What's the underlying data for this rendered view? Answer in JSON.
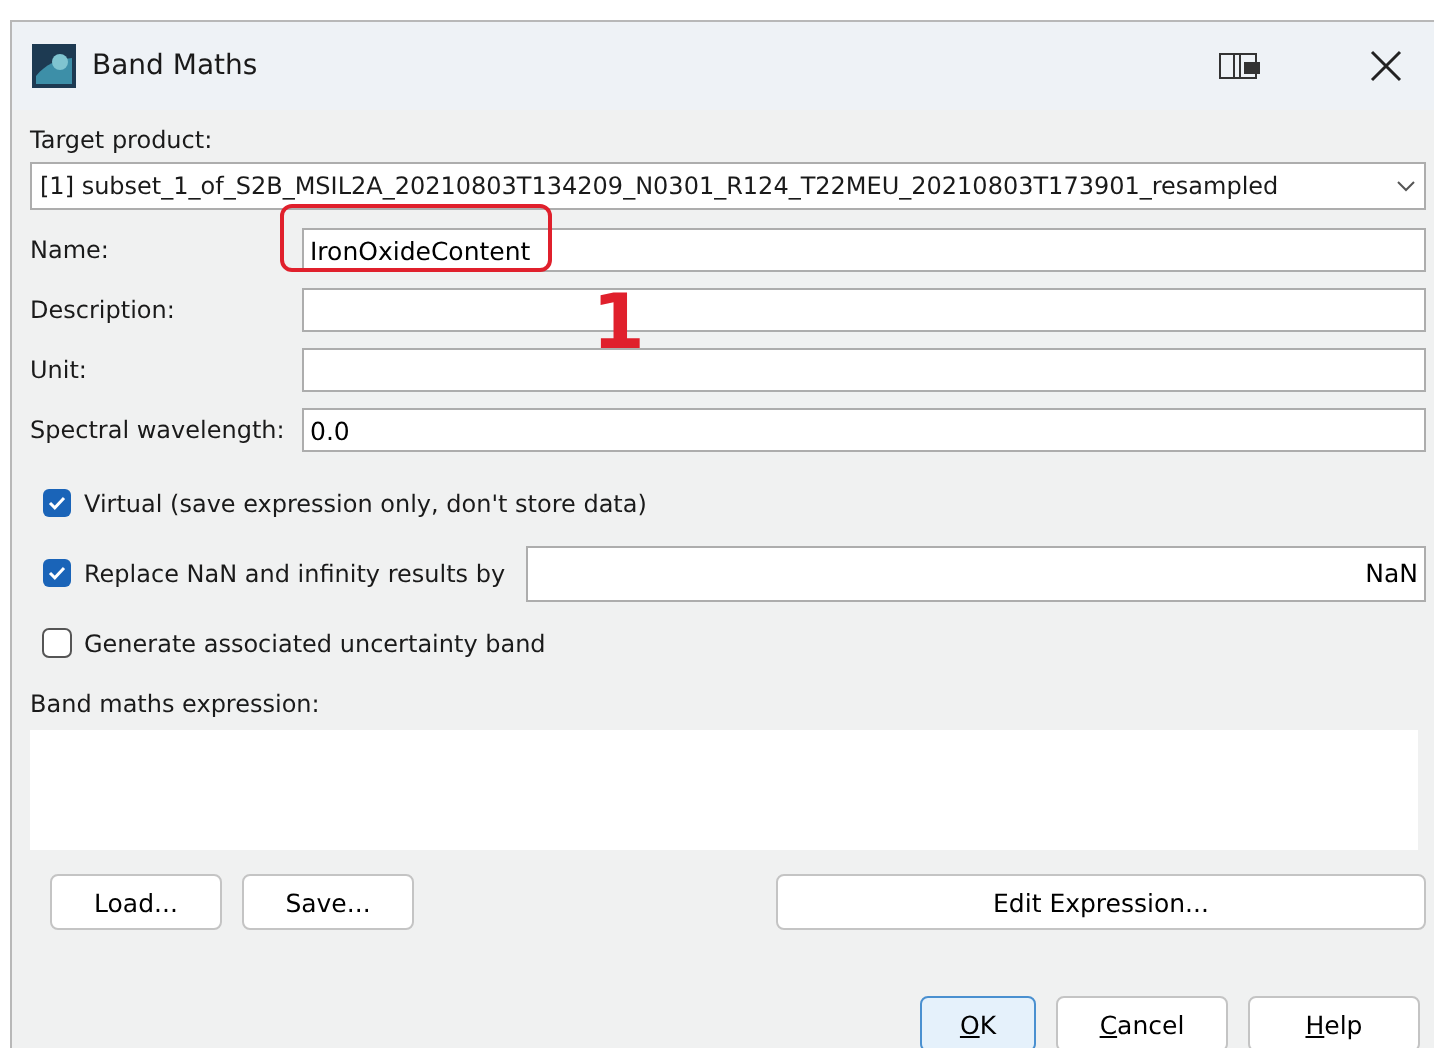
{
  "window": {
    "title": "Band Maths"
  },
  "target_product": {
    "label": "Target product:",
    "value": "[1] subset_1_of_S2B_MSIL2A_20210803T134209_N0301_R124_T22MEU_20210803T173901_resampled"
  },
  "fields": [
    {
      "label": "Name:",
      "value": "IronOxideContent",
      "highlighted": true
    },
    {
      "label": "Description:",
      "highlighted": false
    },
    {
      "label": "Unit:",
      "highlighted": false
    },
    {
      "label": "Spectral wavelength:",
      "value": "0.0",
      "highlighted": false
    }
  ],
  "annotation": {
    "text": "1"
  },
  "options": [
    {
      "label": "Virtual (save expression only, don't store data)",
      "checked": true
    },
    {
      "label": "Replace NaN and infinity results by",
      "checked": true,
      "value": "NaN"
    },
    {
      "label": "Generate associated uncertainty band",
      "checked": false
    }
  ],
  "expression": {
    "label": "Band maths expression:"
  },
  "tool_buttons": [
    {
      "label": "Load...",
      "kind": "small"
    },
    {
      "label": "Save...",
      "kind": "small"
    },
    {
      "label": "Edit Expression...",
      "kind": "wide"
    }
  ],
  "dialog_buttons": [
    {
      "label": "OK",
      "default": true
    },
    {
      "label": "Cancel",
      "default": false
    },
    {
      "label": "Help",
      "default": false
    }
  ]
}
